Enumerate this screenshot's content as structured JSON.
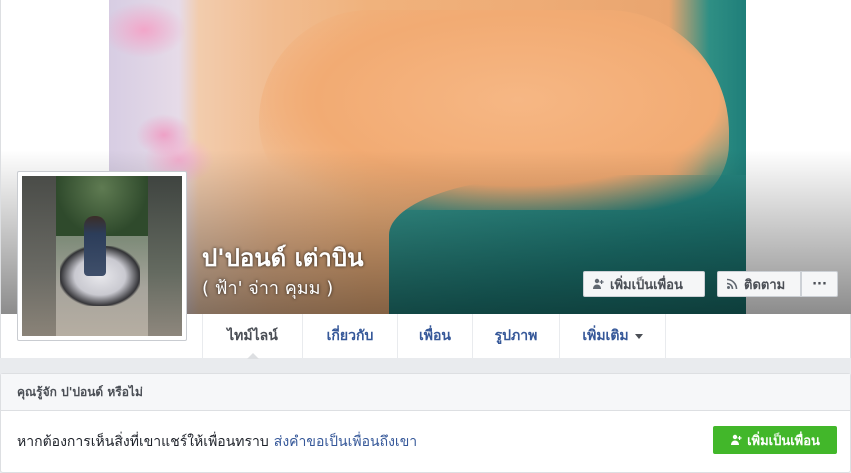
{
  "profile": {
    "name": "ป'ปอนด์ เต่าบิน",
    "alternate_name": "( ฟ้า' จ่าา คุมม )"
  },
  "cover_actions": {
    "add_friend_label": "เพิ่มเป็นเพื่อน",
    "follow_label": "ติดตาม",
    "more_label": "···",
    "add_friend_icon": "add-person-icon",
    "follow_icon": "rss-icon"
  },
  "tabs": [
    {
      "label": "ไทม์ไลน์",
      "active": true
    },
    {
      "label": "เกี่ยวกับ",
      "active": false
    },
    {
      "label": "เพื่อน",
      "active": false
    },
    {
      "label": "รูปภาพ",
      "active": false
    },
    {
      "label": "เพิ่มเติม",
      "active": false
    }
  ],
  "know_box": {
    "title": "คุณรู้จัก ป'ปอนด์ หรือไม่",
    "message": "หากต้องการเห็นสิ่งที่เขาแชร์ให้เพื่อนทราบ",
    "link": "ส่งคำขอเป็นเพื่อนถึงเขา",
    "button_label": "เพิ่มเป็นเพื่อน"
  },
  "colors": {
    "link": "#365899",
    "green_button": "#42b72a",
    "page_background": "#e9ebee"
  }
}
